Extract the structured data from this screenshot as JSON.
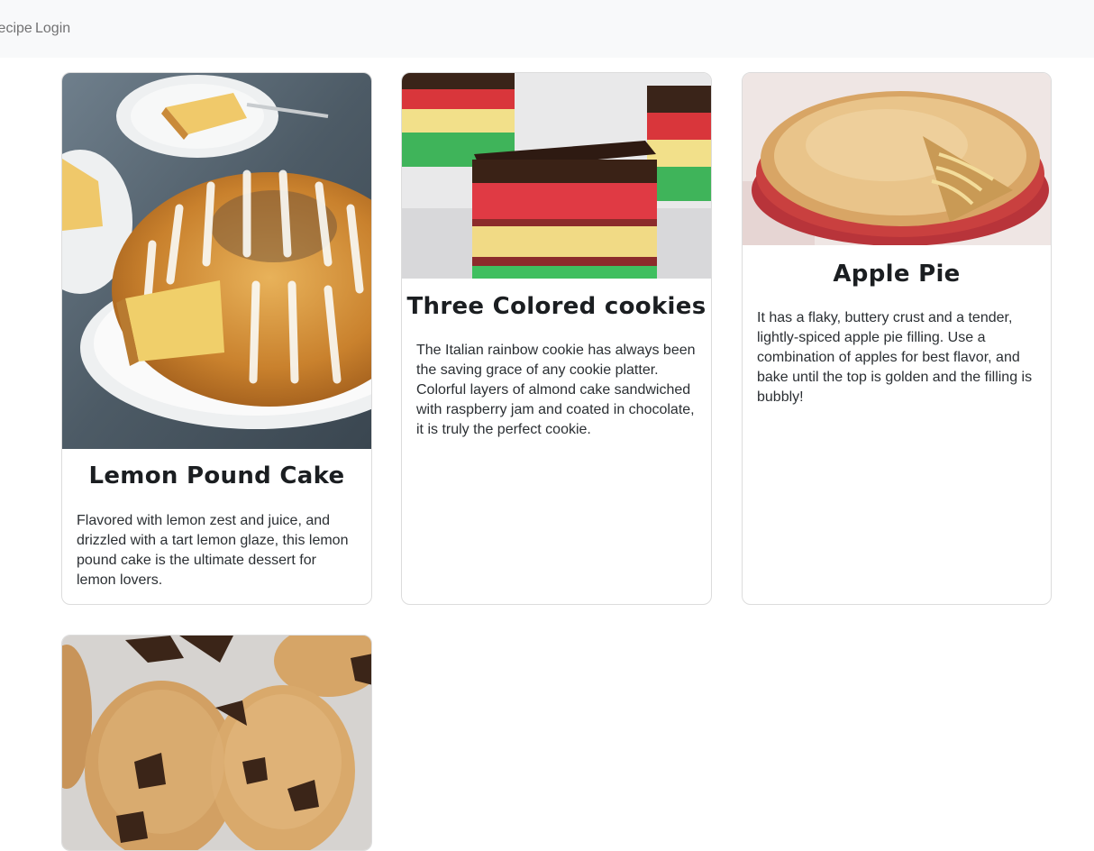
{
  "nav": {
    "recipe_label": "Recipe",
    "login_label": "Login"
  },
  "cards": [
    {
      "title": "Lemon Pound Cake",
      "image": "lemon-bundt-cake-image",
      "text": "Flavored with lemon zest and juice, and drizzled with a tart lemon glaze, this lemon pound cake is the ultimate dessert for lemon lovers."
    },
    {
      "title": "Three Colored cookies",
      "image": "rainbow-cookies-image",
      "text": "The Italian rainbow cookie has always been the saving grace of any cookie platter. Colorful layers of almond cake sandwiched with raspberry jam and coated in chocolate, it is truly the perfect cookie."
    },
    {
      "title": "Apple Pie",
      "image": "apple-pie-image",
      "text": "It has a flaky, buttery crust and a tender, lightly-spiced apple pie filling. Use a combination of apples for best flavor, and bake until the top is golden and the filling is bubbly!"
    },
    {
      "title": "",
      "image": "chocolate-chip-cookies-image",
      "text": ""
    }
  ],
  "colors": {
    "navbar_bg": "#f8f9fa",
    "card_border": "#dcdcdc",
    "text": "#212529"
  }
}
